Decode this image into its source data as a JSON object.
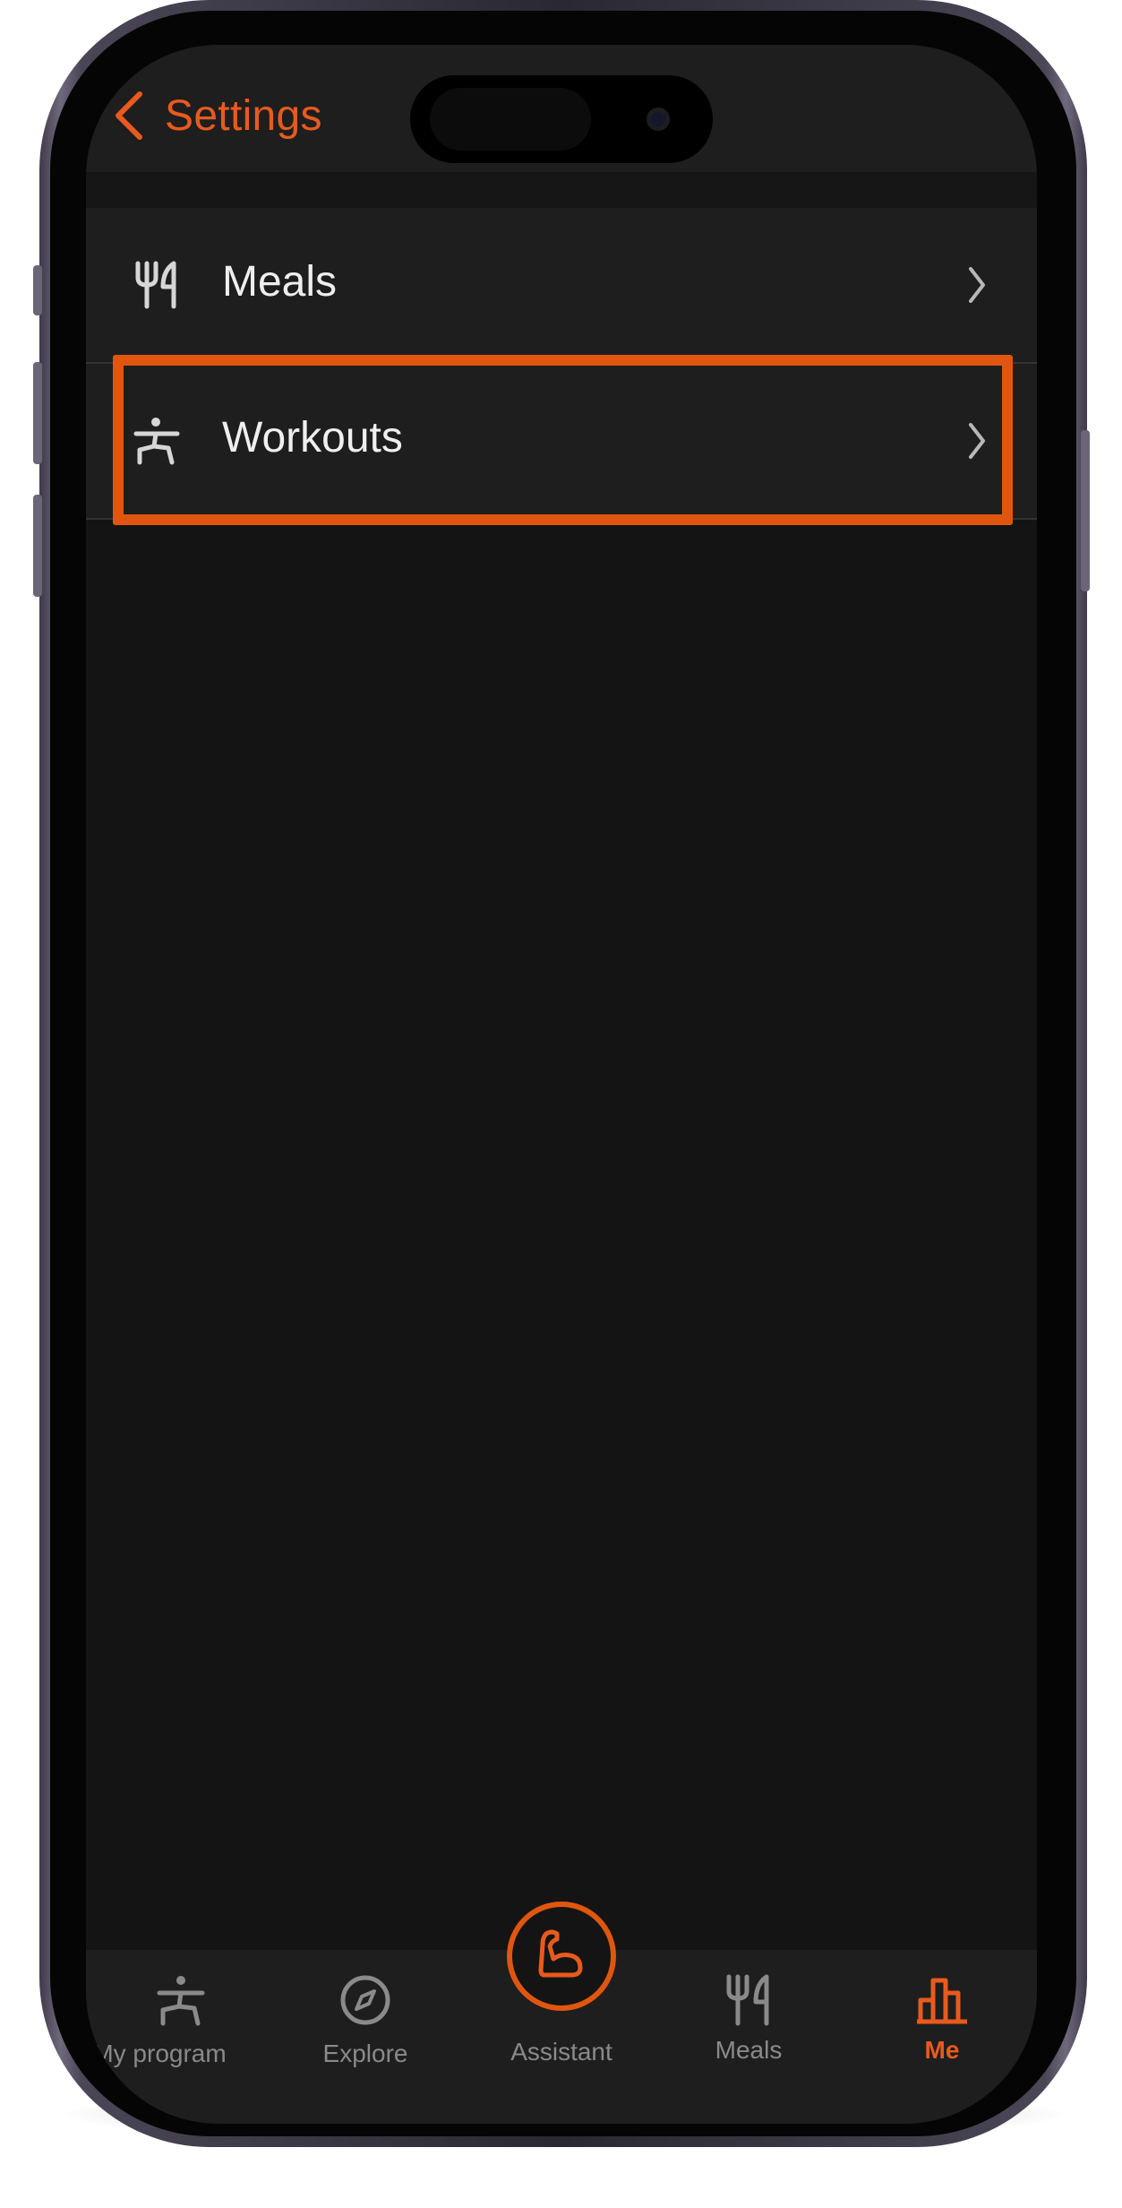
{
  "header": {
    "back_label": "Settings"
  },
  "list": {
    "items": [
      {
        "label": "Meals",
        "icon": "fork-knife-icon"
      },
      {
        "label": "Workouts",
        "icon": "exercise-person-icon",
        "highlighted": true
      }
    ]
  },
  "tab_bar": {
    "items": [
      {
        "label": "My program",
        "icon": "exercise-person-icon"
      },
      {
        "label": "Explore",
        "icon": "compass-icon"
      },
      {
        "label": "Assistant",
        "icon": "flexed-arm-icon"
      },
      {
        "label": "Meals",
        "icon": "fork-knife-icon"
      },
      {
        "label": "Me",
        "icon": "bar-chart-icon",
        "active": true
      }
    ]
  },
  "colors": {
    "accent": "#e85a1e",
    "highlight": "#e1560f",
    "background": "#141414",
    "surface": "#1e1e1e",
    "text": "#efefef",
    "inactive_tab": "#8a8a8a"
  }
}
